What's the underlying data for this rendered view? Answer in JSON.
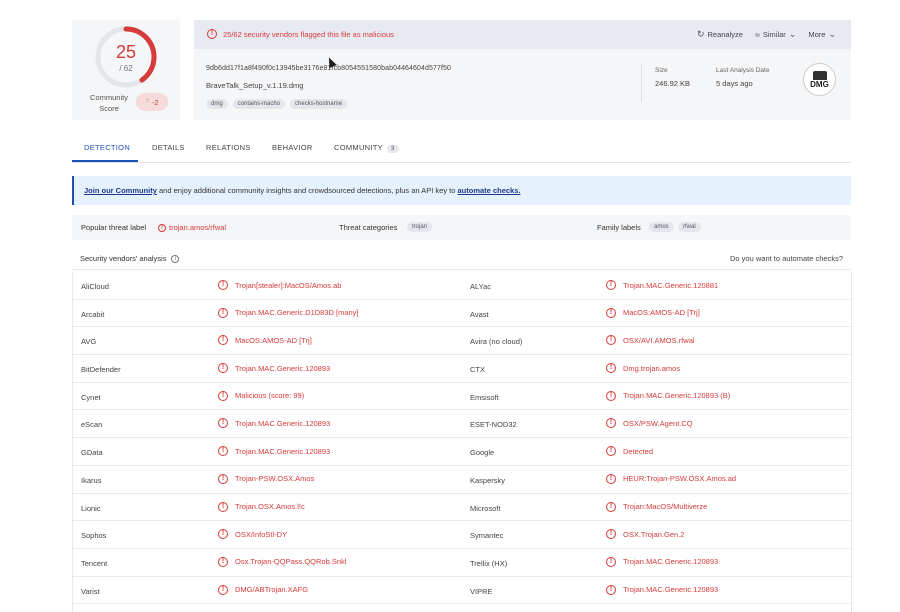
{
  "score": {
    "detections": "25",
    "total": "/ 62",
    "fraction_flagged": 0.403,
    "community_label": "Community Score",
    "community_value": "-2",
    "community_icon": "question-icon"
  },
  "header": {
    "alert_text": "25/62 security vendors flagged this file as malicious",
    "actions": {
      "reanalyze": "Reanalyze",
      "similar": "Similar",
      "more": "More"
    },
    "hash": "9db6dd17f1a8f490f0c13945be3176e81fcb8054551580bab04464604d577f50",
    "filename": "BraveTalk_Setup_v.1.19.dmg",
    "tags": [
      "dmg",
      "contains-macho",
      "checks-hostname"
    ],
    "size_label": "Size",
    "size_value": "246.92 KB",
    "last_analysis_label": "Last Analysis Date",
    "last_analysis_value": "5 days ago",
    "file_type": "DMG"
  },
  "tabs": [
    {
      "label": "DETECTION",
      "active": true
    },
    {
      "label": "DETAILS"
    },
    {
      "label": "RELATIONS"
    },
    {
      "label": "BEHAVIOR"
    },
    {
      "label": "COMMUNITY",
      "badge": "3"
    }
  ],
  "banner": {
    "join_link": "Join our Community",
    "middle_text": " and enjoy additional community insights and crowdsourced detections, plus an API key to ",
    "automate_link": "automate checks."
  },
  "threat": {
    "popular_label": "Popular threat label",
    "popular_value": "trojan.amos/rfwal",
    "categories_label": "Threat categories",
    "categories": [
      "trojan"
    ],
    "family_label": "Family labels",
    "families": [
      "amos",
      "rfwal"
    ]
  },
  "vendors": {
    "title": "Security vendors' analysis",
    "automate_question": "Do you want to automate checks?",
    "rows": [
      {
        "v1": "AliCloud",
        "r1": "Trojan[stealer]:MacOS/Amos.ab",
        "v2": "ALYac",
        "r2": "Trojan.MAC.Generic.120881"
      },
      {
        "v1": "Arcabit",
        "r1": "Trojan.MAC.Generic.D1D83D [many]",
        "v2": "Avast",
        "r2": "MacOS:AMOS-AD [Trj]"
      },
      {
        "v1": "AVG",
        "r1": "MacOS:AMOS-AD [Trj]",
        "v2": "Avira (no cloud)",
        "r2": "OSX/AVI.AMOS.rfwal"
      },
      {
        "v1": "BitDefender",
        "r1": "Trojan.MAC.Generic.120893",
        "v2": "CTX",
        "r2": "Dmg.trojan.amos"
      },
      {
        "v1": "Cynet",
        "r1": "Malicious (score: 99)",
        "v2": "Emsisoft",
        "r2": "Trojan.MAC.Generic.120893 (B)"
      },
      {
        "v1": "eScan",
        "r1": "Trojan.MAC.Generic.120893",
        "v2": "ESET-NOD32",
        "r2": "OSX/PSW.Agent.CQ"
      },
      {
        "v1": "GData",
        "r1": "Trojan.MAC.Generic.120893",
        "v2": "Google",
        "r2": "Detected"
      },
      {
        "v1": "Ikarus",
        "r1": "Trojan-PSW.OSX.Amos",
        "v2": "Kaspersky",
        "r2": "HEUR:Trojan-PSW.OSX.Amos.ad"
      },
      {
        "v1": "Lionic",
        "r1": "Trojan.OSX.Amos.l!c",
        "v2": "Microsoft",
        "r2": "Trojan:MacOS/Multiverze"
      },
      {
        "v1": "Sophos",
        "r1": "OSX/InfoStl-DY",
        "v2": "Symantec",
        "r2": "OSX.Trojan.Gen.2"
      },
      {
        "v1": "Tencent",
        "r1": "Osx.Trojan-QQPass.QQRob.Snkl",
        "v2": "Trellix (HX)",
        "r2": "Trojan.MAC.Generic.120893"
      },
      {
        "v1": "Varist",
        "r1": "DMG/ABTrojan.XAFG",
        "v2": "VIPRE",
        "r2": "Trojan.MAC.Generic.120893"
      }
    ]
  },
  "colors": {
    "malicious": "#d63a3a",
    "accent": "#1d4fb8"
  }
}
